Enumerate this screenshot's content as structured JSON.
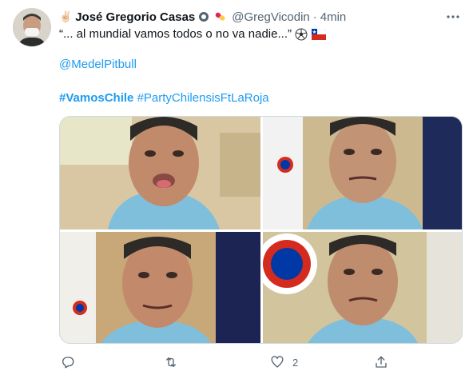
{
  "tweet": {
    "name_emoji": "✌🏻",
    "display_name": "José Gregorio Casas",
    "handle": "@GregVicodin",
    "separator": "·",
    "time": "4min",
    "text_line1": "“... al mundial vamos todos o no va nadie...”",
    "mention": "@MedelPitbull",
    "hashtag1": "#VamosChile",
    "hashtag2": "#PartyChilensisFtLaRoja"
  },
  "actions": {
    "reply_count": "",
    "retweet_count": "",
    "like_count": "2"
  },
  "icons": {
    "more": "more-horizontal-icon",
    "reply": "reply-icon",
    "retweet": "retweet-icon",
    "like": "heart-icon",
    "share": "share-icon",
    "verified": "verified-badge-icon"
  },
  "colors": {
    "link": "#1d9bf0",
    "secondary_text": "#536471",
    "border": "#cfd9de"
  }
}
